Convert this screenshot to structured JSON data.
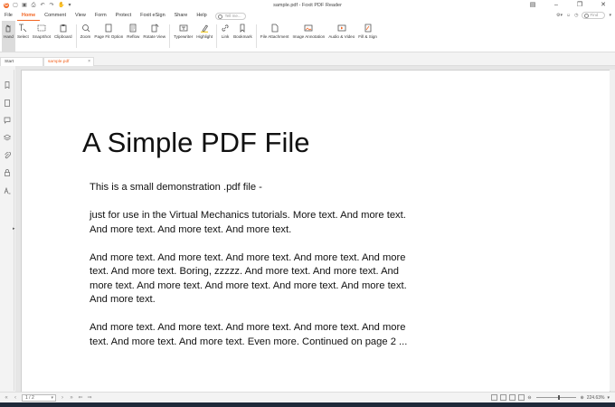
{
  "window": {
    "title": "sample.pdf - Foxit PDF Reader"
  },
  "menubar": {
    "items": [
      "File",
      "Home",
      "Comment",
      "View",
      "Form",
      "Protect",
      "Foxit eSign",
      "Share",
      "Help"
    ],
    "active_index": 1,
    "tell_me_placeholder": "Tell me...",
    "find_placeholder": "Find"
  },
  "ribbon": {
    "tools": [
      {
        "label": "Hand",
        "icon": "hand-icon",
        "selected": true
      },
      {
        "label": "Select",
        "icon": "select-text-icon"
      },
      {
        "label": "SnapShot",
        "icon": "snapshot-icon"
      },
      {
        "label": "Clipboard",
        "icon": "clipboard-icon"
      },
      {
        "label": "Zoom",
        "icon": "zoom-icon"
      },
      {
        "label": "Page Fit Option",
        "icon": "page-fit-icon"
      },
      {
        "label": "Reflow",
        "icon": "reflow-icon"
      },
      {
        "label": "Rotate View",
        "icon": "rotate-view-icon"
      },
      {
        "label": "Typewriter",
        "icon": "typewriter-icon"
      },
      {
        "label": "Highlight",
        "icon": "highlight-icon"
      },
      {
        "label": "Link",
        "icon": "link-icon"
      },
      {
        "label": "Bookmark",
        "icon": "bookmark-icon"
      },
      {
        "label": "File Attachment",
        "icon": "file-attachment-icon"
      },
      {
        "label": "Image Annotation",
        "icon": "image-annotation-icon"
      },
      {
        "label": "Audio & Video",
        "icon": "audio-video-icon"
      },
      {
        "label": "Fill & Sign",
        "icon": "fill-sign-icon"
      }
    ]
  },
  "tabs": [
    {
      "label": "Start"
    },
    {
      "label": "sample.pdf"
    }
  ],
  "document": {
    "title": "A Simple PDF File",
    "paragraphs": [
      "This is a small demonstration .pdf file -",
      "just for use in the Virtual Mechanics tutorials. More text. And more text. And more text. And more text. And more text.",
      "And more text. And more text. And more text. And more text. And more text. And more text. Boring, zzzzz. And more text. And more text. And more text. And more text. And more text. And more text. And more text. And more text.",
      "And more text. And more text. And more text. And more text. And more text. And more text. And more text. Even more. Continued on page 2 ..."
    ]
  },
  "statusbar": {
    "page_indicator": "1 / 2",
    "zoom": "224.63%"
  },
  "colors": {
    "accent": "#f26522"
  }
}
